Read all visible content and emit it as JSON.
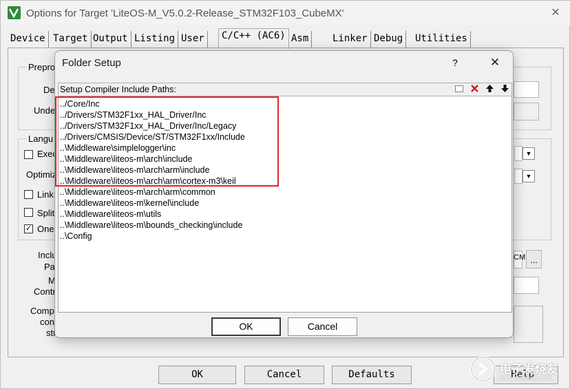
{
  "parent": {
    "title": "Options for Target 'LiteOS-M_V5.0.2-Release_STM32F103_CubeMX'",
    "close_glyph": "✕",
    "tabs": [
      "Device",
      "Target",
      "Output",
      "Listing",
      "User",
      "C/C++ (AC6)",
      "Asm",
      "Linker",
      "Debug",
      "Utilities"
    ],
    "active_tab": "C/C++ (AC6)",
    "fragments": {
      "prepro": "Prepro",
      "de": "De",
      "unde": "Unde",
      "langu": "Langu",
      "exec": "Exec",
      "optimiz": "Optimiz",
      "link": "Link",
      "split": "Split",
      "one": "One",
      "inclu": "Inclu",
      "pa": "Pa",
      "m": "M",
      "contr": "Contr",
      "comp": "Comp",
      "con": "con",
      "str": "str",
      "cn": "CM",
      "browse": "..."
    },
    "buttons": {
      "ok": "OK",
      "cancel": "Cancel",
      "defaults": "Defaults",
      "help": "Help"
    }
  },
  "dialog": {
    "title": "Folder Setup",
    "help_glyph": "?",
    "close_glyph": "✕",
    "list_label": "Setup Compiler Include Paths:",
    "paths": [
      "../Core/Inc",
      "../Drivers/STM32F1xx_HAL_Driver/Inc",
      "../Drivers/STM32F1xx_HAL_Driver/Inc/Legacy",
      "../Drivers/CMSIS/Device/ST/STM32F1xx/Include",
      "..\\Middleware\\simplelogger\\inc",
      "..\\Middleware\\liteos-m\\arch\\include",
      "..\\Middleware\\liteos-m\\arch\\arm\\include",
      "..\\Middleware\\liteos-m\\arch\\arm\\cortex-m3\\keil",
      "..\\Middleware\\liteos-m\\arch\\arm\\common",
      "..\\Middleware\\liteos-m\\kernel\\include",
      "..\\Middleware\\liteos-m\\utils",
      "..\\Middleware\\liteos-m\\bounds_checking\\include",
      "..\\Config"
    ],
    "ok_label": "OK",
    "cancel_label": "Cancel",
    "highlight_color": "#e0282a"
  },
  "watermark": {
    "text": "电子发烧友",
    "sub": "www.elecfans.com"
  }
}
